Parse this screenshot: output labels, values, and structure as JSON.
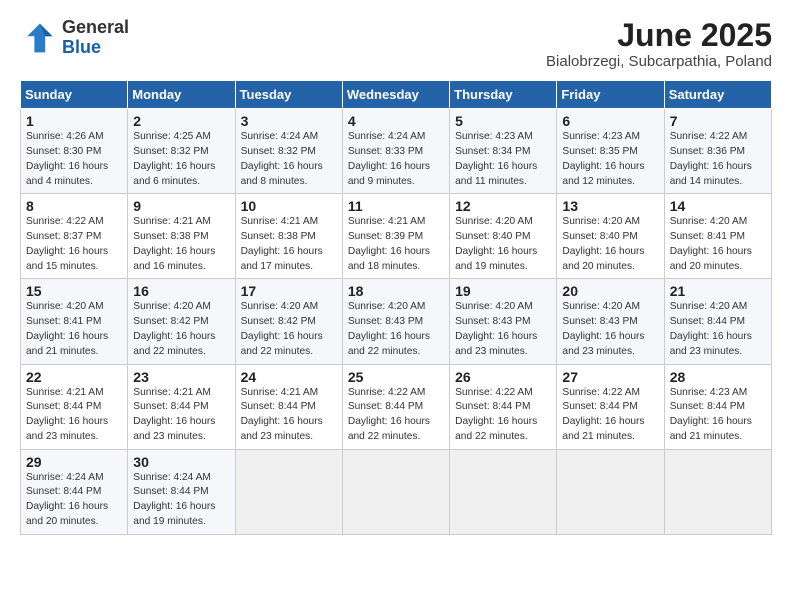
{
  "logo": {
    "general": "General",
    "blue": "Blue"
  },
  "title": "June 2025",
  "subtitle": "Bialobrzegi, Subcarpathia, Poland",
  "days_of_week": [
    "Sunday",
    "Monday",
    "Tuesday",
    "Wednesday",
    "Thursday",
    "Friday",
    "Saturday"
  ],
  "weeks": [
    [
      {
        "day": 1,
        "lines": [
          "Sunrise: 4:26 AM",
          "Sunset: 8:30 PM",
          "Daylight: 16 hours",
          "and 4 minutes."
        ]
      },
      {
        "day": 2,
        "lines": [
          "Sunrise: 4:25 AM",
          "Sunset: 8:32 PM",
          "Daylight: 16 hours",
          "and 6 minutes."
        ]
      },
      {
        "day": 3,
        "lines": [
          "Sunrise: 4:24 AM",
          "Sunset: 8:32 PM",
          "Daylight: 16 hours",
          "and 8 minutes."
        ]
      },
      {
        "day": 4,
        "lines": [
          "Sunrise: 4:24 AM",
          "Sunset: 8:33 PM",
          "Daylight: 16 hours",
          "and 9 minutes."
        ]
      },
      {
        "day": 5,
        "lines": [
          "Sunrise: 4:23 AM",
          "Sunset: 8:34 PM",
          "Daylight: 16 hours",
          "and 11 minutes."
        ]
      },
      {
        "day": 6,
        "lines": [
          "Sunrise: 4:23 AM",
          "Sunset: 8:35 PM",
          "Daylight: 16 hours",
          "and 12 minutes."
        ]
      },
      {
        "day": 7,
        "lines": [
          "Sunrise: 4:22 AM",
          "Sunset: 8:36 PM",
          "Daylight: 16 hours",
          "and 14 minutes."
        ]
      }
    ],
    [
      {
        "day": 8,
        "lines": [
          "Sunrise: 4:22 AM",
          "Sunset: 8:37 PM",
          "Daylight: 16 hours",
          "and 15 minutes."
        ]
      },
      {
        "day": 9,
        "lines": [
          "Sunrise: 4:21 AM",
          "Sunset: 8:38 PM",
          "Daylight: 16 hours",
          "and 16 minutes."
        ]
      },
      {
        "day": 10,
        "lines": [
          "Sunrise: 4:21 AM",
          "Sunset: 8:38 PM",
          "Daylight: 16 hours",
          "and 17 minutes."
        ]
      },
      {
        "day": 11,
        "lines": [
          "Sunrise: 4:21 AM",
          "Sunset: 8:39 PM",
          "Daylight: 16 hours",
          "and 18 minutes."
        ]
      },
      {
        "day": 12,
        "lines": [
          "Sunrise: 4:20 AM",
          "Sunset: 8:40 PM",
          "Daylight: 16 hours",
          "and 19 minutes."
        ]
      },
      {
        "day": 13,
        "lines": [
          "Sunrise: 4:20 AM",
          "Sunset: 8:40 PM",
          "Daylight: 16 hours",
          "and 20 minutes."
        ]
      },
      {
        "day": 14,
        "lines": [
          "Sunrise: 4:20 AM",
          "Sunset: 8:41 PM",
          "Daylight: 16 hours",
          "and 20 minutes."
        ]
      }
    ],
    [
      {
        "day": 15,
        "lines": [
          "Sunrise: 4:20 AM",
          "Sunset: 8:41 PM",
          "Daylight: 16 hours",
          "and 21 minutes."
        ]
      },
      {
        "day": 16,
        "lines": [
          "Sunrise: 4:20 AM",
          "Sunset: 8:42 PM",
          "Daylight: 16 hours",
          "and 22 minutes."
        ]
      },
      {
        "day": 17,
        "lines": [
          "Sunrise: 4:20 AM",
          "Sunset: 8:42 PM",
          "Daylight: 16 hours",
          "and 22 minutes."
        ]
      },
      {
        "day": 18,
        "lines": [
          "Sunrise: 4:20 AM",
          "Sunset: 8:43 PM",
          "Daylight: 16 hours",
          "and 22 minutes."
        ]
      },
      {
        "day": 19,
        "lines": [
          "Sunrise: 4:20 AM",
          "Sunset: 8:43 PM",
          "Daylight: 16 hours",
          "and 23 minutes."
        ]
      },
      {
        "day": 20,
        "lines": [
          "Sunrise: 4:20 AM",
          "Sunset: 8:43 PM",
          "Daylight: 16 hours",
          "and 23 minutes."
        ]
      },
      {
        "day": 21,
        "lines": [
          "Sunrise: 4:20 AM",
          "Sunset: 8:44 PM",
          "Daylight: 16 hours",
          "and 23 minutes."
        ]
      }
    ],
    [
      {
        "day": 22,
        "lines": [
          "Sunrise: 4:21 AM",
          "Sunset: 8:44 PM",
          "Daylight: 16 hours",
          "and 23 minutes."
        ]
      },
      {
        "day": 23,
        "lines": [
          "Sunrise: 4:21 AM",
          "Sunset: 8:44 PM",
          "Daylight: 16 hours",
          "and 23 minutes."
        ]
      },
      {
        "day": 24,
        "lines": [
          "Sunrise: 4:21 AM",
          "Sunset: 8:44 PM",
          "Daylight: 16 hours",
          "and 23 minutes."
        ]
      },
      {
        "day": 25,
        "lines": [
          "Sunrise: 4:22 AM",
          "Sunset: 8:44 PM",
          "Daylight: 16 hours",
          "and 22 minutes."
        ]
      },
      {
        "day": 26,
        "lines": [
          "Sunrise: 4:22 AM",
          "Sunset: 8:44 PM",
          "Daylight: 16 hours",
          "and 22 minutes."
        ]
      },
      {
        "day": 27,
        "lines": [
          "Sunrise: 4:22 AM",
          "Sunset: 8:44 PM",
          "Daylight: 16 hours",
          "and 21 minutes."
        ]
      },
      {
        "day": 28,
        "lines": [
          "Sunrise: 4:23 AM",
          "Sunset: 8:44 PM",
          "Daylight: 16 hours",
          "and 21 minutes."
        ]
      }
    ],
    [
      {
        "day": 29,
        "lines": [
          "Sunrise: 4:24 AM",
          "Sunset: 8:44 PM",
          "Daylight: 16 hours",
          "and 20 minutes."
        ]
      },
      {
        "day": 30,
        "lines": [
          "Sunrise: 4:24 AM",
          "Sunset: 8:44 PM",
          "Daylight: 16 hours",
          "and 19 minutes."
        ]
      },
      null,
      null,
      null,
      null,
      null
    ]
  ]
}
